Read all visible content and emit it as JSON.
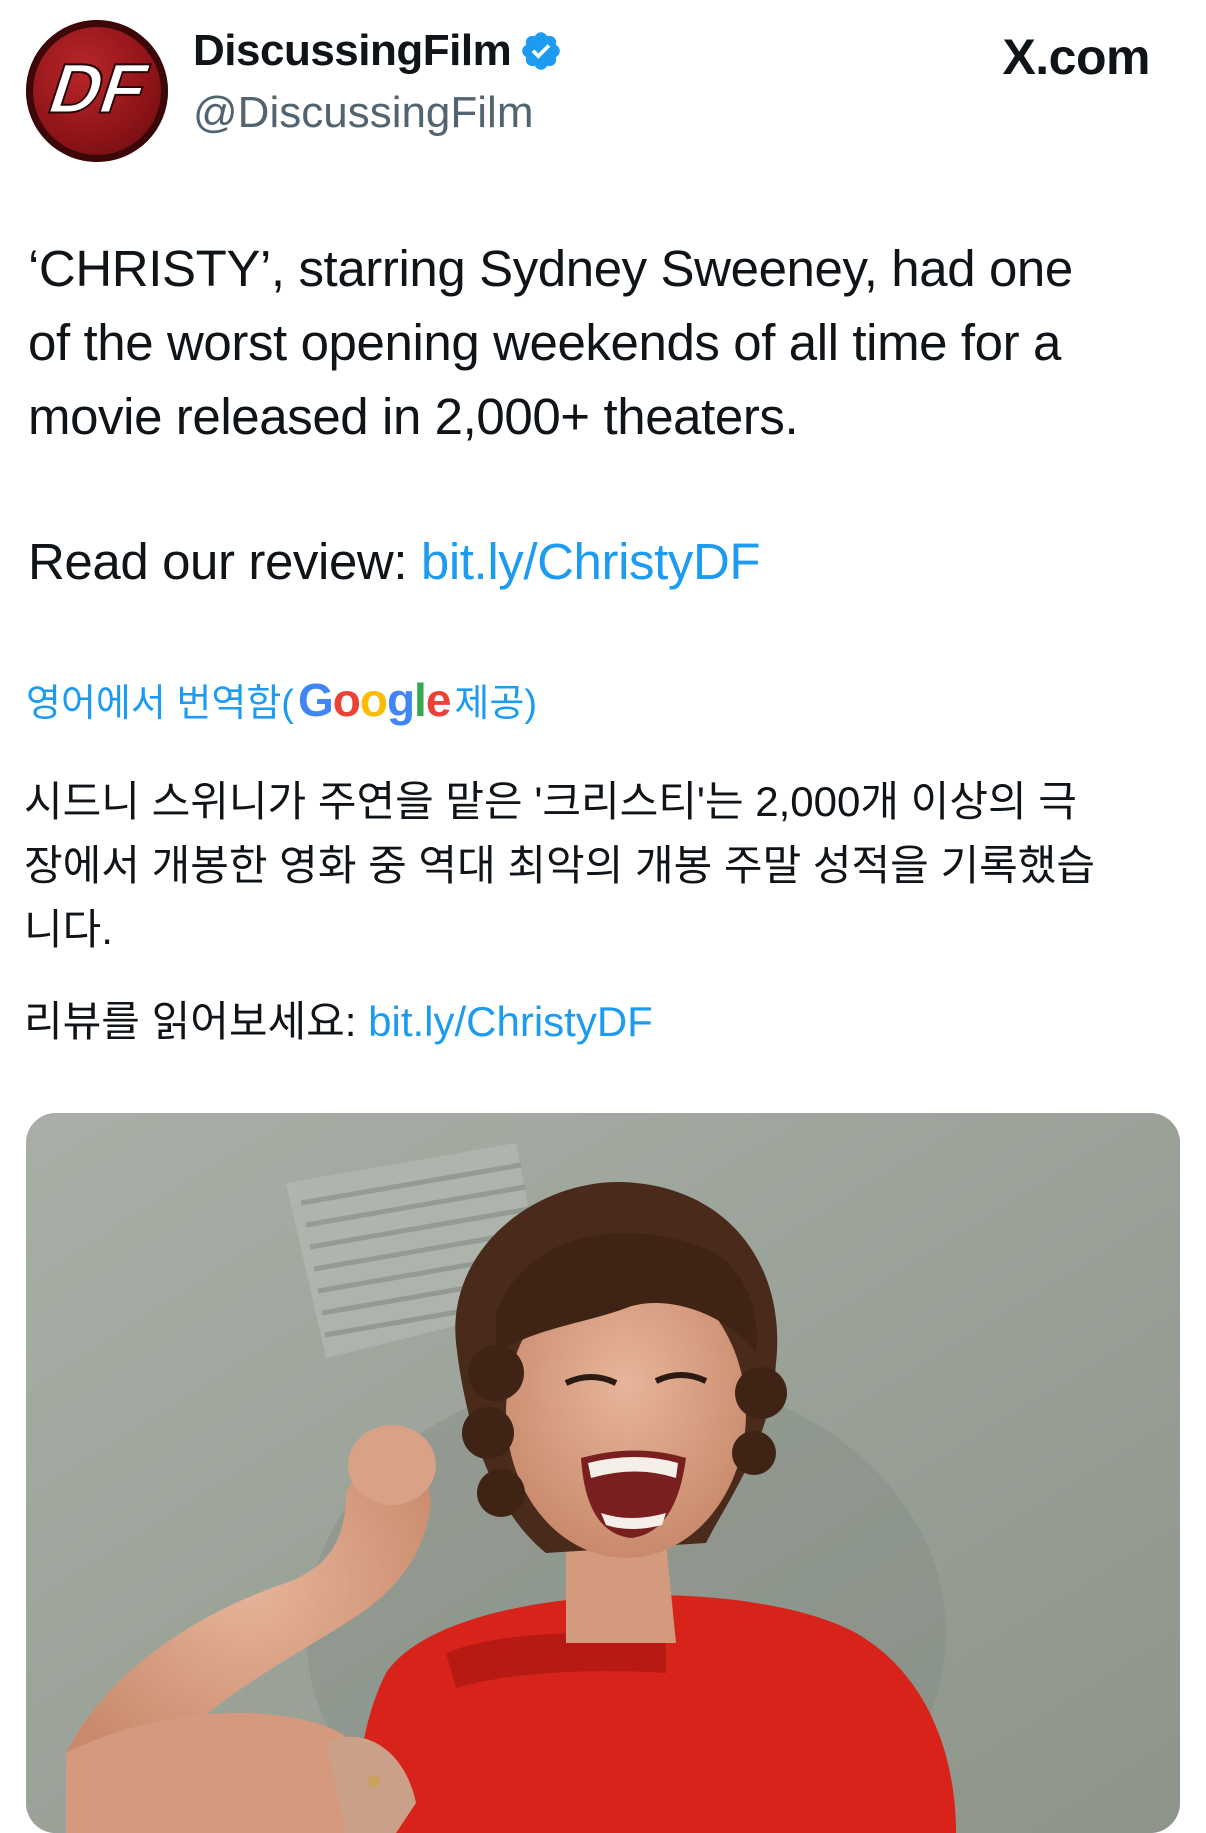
{
  "author": {
    "display_name": "DiscussingFilm",
    "handle": "@DiscussingFilm",
    "avatar_text": "DF",
    "verified": true
  },
  "site": {
    "label": "X.com"
  },
  "tweet": {
    "lines": [
      "‘CHRISTY’, starring Sydney Sweeney, had one",
      "of the worst opening weekends of all time for a",
      "movie released in 2,000+ theaters."
    ],
    "review_prefix": "Read our review: ",
    "review_link": "bit.ly/ChristyDF"
  },
  "translation": {
    "label_prefix": "영어에서 번역함(",
    "provider_letters": [
      "G",
      "o",
      "o",
      "g",
      "l",
      "e"
    ],
    "label_suffix": " 제공)",
    "lines": [
      "시드니 스위니가 주연을 맡은 '크리스티'는 2,000개 이상의 극",
      "장에서 개봉한 영화 중 역대 최악의 개봉 주말 성적을 기록했습",
      "니다."
    ],
    "review_prefix": "리뷰를 읽어보세요: ",
    "review_link": "bit.ly/ChristyDF"
  },
  "colors": {
    "link": "#1d9bf0",
    "secondary_text": "#536471",
    "verified_badge": "#1d9bf0",
    "avatar_red": "#b8262a"
  },
  "icons": {
    "verified": "verified-badge-icon",
    "avatar": "discussingfilm-logo"
  }
}
